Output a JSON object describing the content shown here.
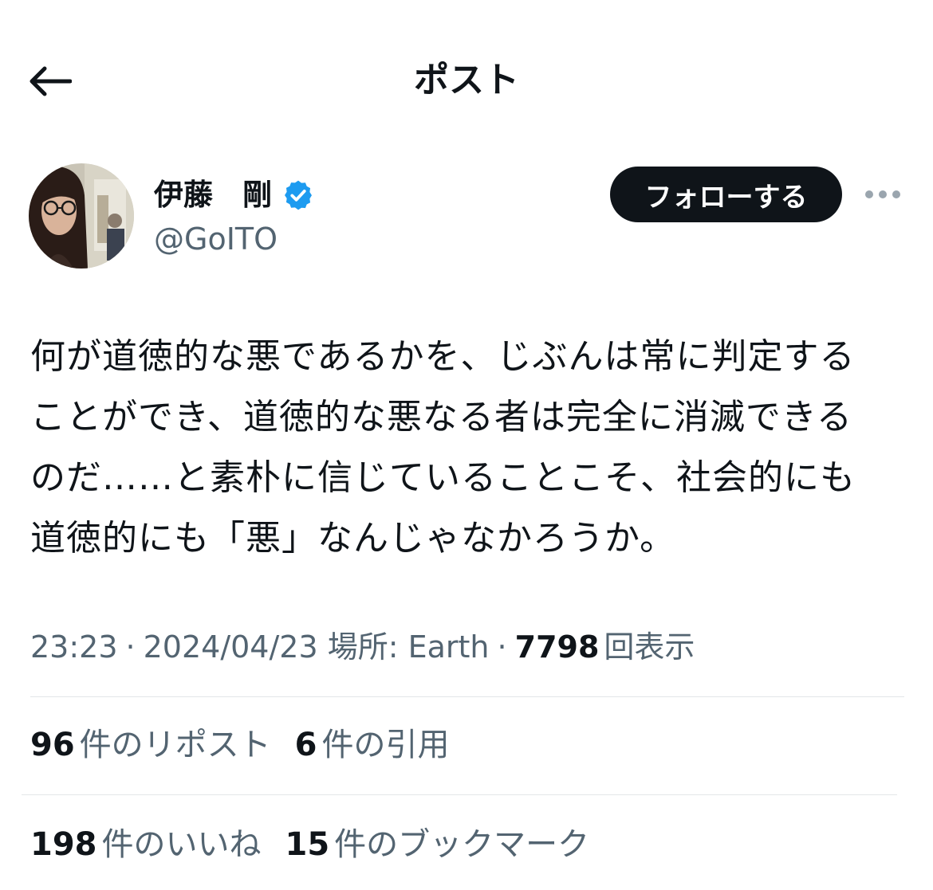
{
  "header": {
    "title": "ポスト",
    "back_icon": "arrow-left-icon"
  },
  "author": {
    "name": "伊藤　剛",
    "handle": "@GoITO",
    "verified_icon": "verified-badge-icon",
    "verified_color": "#1d9bf0"
  },
  "actions": {
    "follow_label": "フォローする",
    "more_icon": "more-horizontal-icon"
  },
  "post": {
    "lines": [
      "何が道徳的な悪であるかを、じぶんは常に判定する",
      "ことができ、道徳的な悪なる者は完全に消滅できる",
      "のだ……と素朴に信じていることこそ、社会的にも",
      "道徳的にも「悪」なんじゃなかろうか。"
    ]
  },
  "meta": {
    "time": "23:23",
    "separator": "·",
    "date": "2024/04/23",
    "location_label": "場所: Earth",
    "views_count": "7798",
    "views_label": "回表示"
  },
  "stats": {
    "reposts_count": "96",
    "reposts_label": "件のリポスト",
    "quotes_count": "6",
    "quotes_label": "件の引用",
    "likes_count": "198",
    "likes_label": "件のいいね",
    "bookmarks_count": "15",
    "bookmarks_label": "件のブックマーク"
  },
  "colors": {
    "text_primary": "#0f1419",
    "text_secondary": "#536471",
    "follow_button_bg": "#0f1419",
    "divider": "#e3e6e8"
  }
}
